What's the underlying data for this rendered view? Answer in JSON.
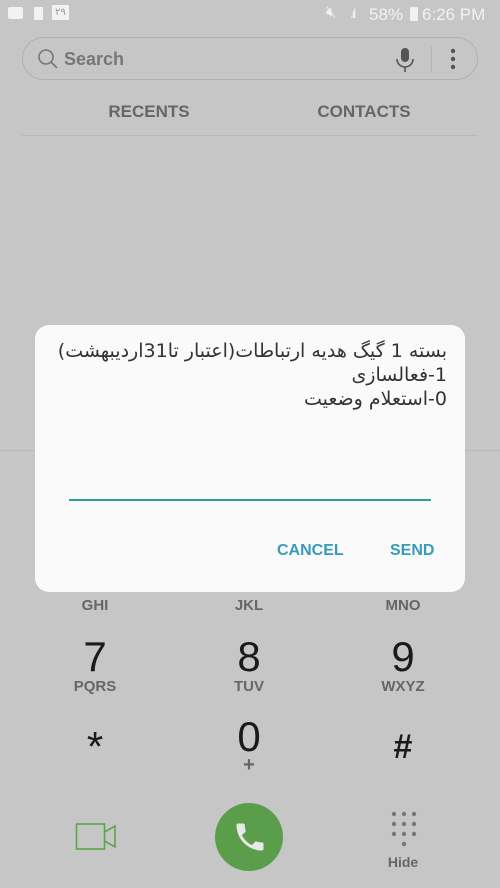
{
  "status_bar": {
    "battery": "58%",
    "time": "6:26 PM",
    "notification_badge": "۲۹"
  },
  "search": {
    "placeholder": "Search"
  },
  "tabs": [
    {
      "label": "RECENTS"
    },
    {
      "label": "CONTACTS"
    }
  ],
  "dialog": {
    "lines": [
      "بسته 1 گیگ هدیه ارتباطات(اعتبار تا31اردیبهشت)",
      "1-فعالسازی",
      "0-استعلام وضعیت"
    ],
    "input_value": "",
    "cancel_label": "CANCEL",
    "send_label": "SEND",
    "accent": "#2a9d9d"
  },
  "keypad": {
    "row_partial": [
      "GHI",
      "JKL",
      "MNO"
    ],
    "keys": [
      {
        "digit": "7",
        "letters": "PQRS"
      },
      {
        "digit": "8",
        "letters": "TUV"
      },
      {
        "digit": "9",
        "letters": "WXYZ"
      },
      {
        "digit": "*",
        "letters": ""
      },
      {
        "digit": "0",
        "letters": "+"
      },
      {
        "digit": "#",
        "letters": ""
      }
    ]
  },
  "bottom": {
    "hide_label": "Hide",
    "call_color": "#5a9e4b",
    "video_color": "#5aa64b"
  }
}
